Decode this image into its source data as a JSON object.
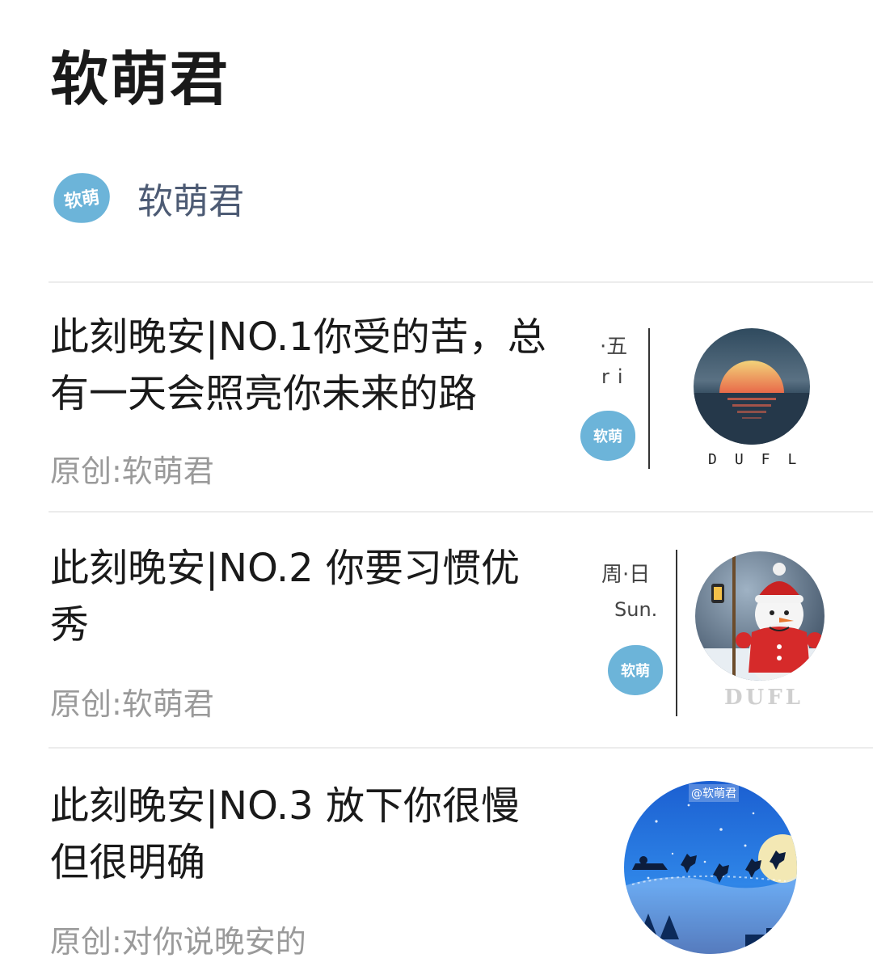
{
  "header": {
    "title": "软萌君",
    "author_name": "软萌君",
    "author_logo_text": "软萌",
    "logo_color": "#6cb4d9"
  },
  "articles": [
    {
      "title": "此刻晚安|NO.1你受的苦，总有一天会照亮你未来的路",
      "source": "原创:软萌君",
      "thumb": {
        "day_cn": "·五",
        "day_en": "ri",
        "logo_text": "软萌",
        "brand": "DUFL",
        "image": "sunset-over-sea"
      }
    },
    {
      "title": "此刻晚安|NO.2 你要习惯优秀",
      "source": "原创:软萌君",
      "thumb": {
        "day_cn": "周·日",
        "day_en": "Sun.",
        "logo_text": "软萌",
        "brand": "DUFL",
        "image": "snowman-with-lantern"
      }
    },
    {
      "title": "此刻晚安|NO.3 放下你很慢但很明确",
      "source": "原创:对你说晚安的",
      "thumb": {
        "watermark": "@软萌君",
        "image": "santa-sleigh-reindeer-night"
      }
    }
  ]
}
